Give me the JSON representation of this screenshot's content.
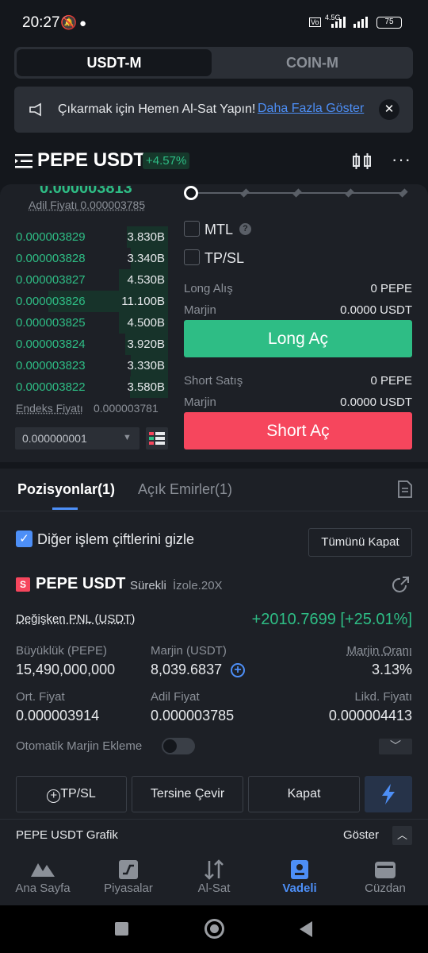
{
  "status_bar": {
    "time": "20:27",
    "battery": "75",
    "network": "4.5G"
  },
  "segment": {
    "active": "USDT-M",
    "inactive": "COIN-M"
  },
  "banner": {
    "text": "Çıkarmak için Hemen Al-Sat Yapın!",
    "link": "Daha Fazla Göster"
  },
  "header": {
    "pair": "PEPE USDT",
    "change": "+4.57%"
  },
  "orderbook": {
    "last_price": "0.000003813",
    "fair_label": "Adil Fiyatı",
    "fair_value": "0.000003785",
    "rows": [
      {
        "price": "0.000003829",
        "qty": "3.830B",
        "depth": 0.27
      },
      {
        "price": "0.000003828",
        "qty": "3.340B",
        "depth": 0.24
      },
      {
        "price": "0.000003827",
        "qty": "4.530B",
        "depth": 0.32
      },
      {
        "price": "0.000003826",
        "qty": "11.100B",
        "depth": 0.78
      },
      {
        "price": "0.000003825",
        "qty": "4.500B",
        "depth": 0.32
      },
      {
        "price": "0.000003824",
        "qty": "3.920B",
        "depth": 0.28
      },
      {
        "price": "0.000003823",
        "qty": "3.330B",
        "depth": 0.24
      },
      {
        "price": "0.000003822",
        "qty": "3.580B",
        "depth": 0.25
      }
    ],
    "index_label": "Endeks Fiyatı",
    "index_value": "0.000003781",
    "tick_size": "0.000000001"
  },
  "order_form": {
    "slider_percent": 0,
    "mtl": "MTL",
    "tpsl": "TP/SL",
    "long_label": "Long Alış",
    "long_value": "0 PEPE",
    "margin_label": "Marjin",
    "long_margin": "0.0000 USDT",
    "long_button": "Long Aç",
    "short_label": "Short Satış",
    "short_value": "0 PEPE",
    "short_margin": "0.0000 USDT",
    "short_button": "Short Aç"
  },
  "tabs": {
    "positions": "Pozisyonlar(1)",
    "orders": "Açık Emirler(1)"
  },
  "filter": {
    "hide_pairs": "Diğer işlem çiftlerini gizle",
    "close_all": "Tümünü Kapat"
  },
  "position": {
    "badge": "S",
    "pair": "PEPE USDT",
    "type": "Sürekli",
    "mode": "İzole.20X",
    "pnl_label": "Değişken PNL (USDT)",
    "pnl_value": "+2010.7699 [+25.01%]",
    "size_label": "Büyüklük (PEPE)",
    "size_value": "15,490,000,000",
    "margin_label": "Marjin (USDT)",
    "margin_value": "8,039.6837",
    "ratio_label": "Marjin Oranı",
    "ratio_value": "3.13%",
    "avg_label": "Ort. Fiyat",
    "avg_value": "0.000003914",
    "fair_label": "Adil Fiyat",
    "fair_value": "0.000003785",
    "liq_label": "Likd. Fiyatı",
    "liq_value": "0.000004413",
    "auto_margin": "Otomatik Marjin Ekleme",
    "btn_tpsl": "TP/SL",
    "btn_reverse": "Tersine Çevir",
    "btn_close": "Kapat"
  },
  "chart_row": {
    "label": "PEPE USDT Grafik",
    "show": "Göster"
  },
  "nav": [
    {
      "label": "Ana Sayfa",
      "icon": "home-icon",
      "active": false
    },
    {
      "label": "Piyasalar",
      "icon": "markets-icon",
      "active": false
    },
    {
      "label": "Al-Sat",
      "icon": "trade-icon",
      "active": false
    },
    {
      "label": "Vadeli",
      "icon": "futures-icon",
      "active": true
    },
    {
      "label": "Cüzdan",
      "icon": "wallet-icon",
      "active": false
    }
  ],
  "colors": {
    "green": "#2ebd85",
    "red": "#f6465d",
    "accent": "#4d8ff7"
  }
}
